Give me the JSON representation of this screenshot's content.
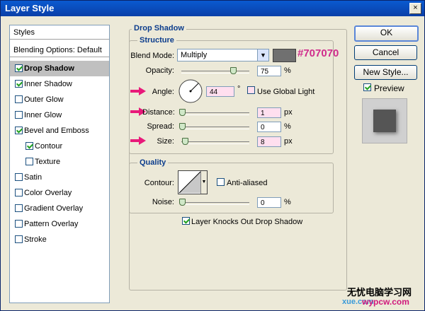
{
  "window": {
    "title": "Layer Style",
    "close_glyph": "×"
  },
  "left_panel": {
    "styles_label": "Styles",
    "blending_label": "Blending Options: Default",
    "items": [
      {
        "label": "Drop Shadow",
        "checked": true,
        "selected": true
      },
      {
        "label": "Inner Shadow",
        "checked": true
      },
      {
        "label": "Outer Glow",
        "checked": false
      },
      {
        "label": "Inner Glow",
        "checked": false
      },
      {
        "label": "Bevel and Emboss",
        "checked": true
      },
      {
        "label": "Contour",
        "checked": true
      },
      {
        "label": "Texture",
        "checked": false
      },
      {
        "label": "Satin",
        "checked": false
      },
      {
        "label": "Color Overlay",
        "checked": false
      },
      {
        "label": "Gradient Overlay",
        "checked": false
      },
      {
        "label": "Pattern Overlay",
        "checked": false
      },
      {
        "label": "Stroke",
        "checked": false
      }
    ]
  },
  "drop_shadow": {
    "group_title": "Drop Shadow",
    "structure_title": "Structure",
    "blend_mode_label": "Blend Mode:",
    "blend_mode_value": "Multiply",
    "color_hex": "#707070",
    "opacity_label": "Opacity:",
    "opacity_value": "75",
    "opacity_unit": "%",
    "opacity_fraction": 0.75,
    "angle_label": "Angle:",
    "angle_value": "44",
    "angle_unit": "°",
    "use_global_light_label": "Use Global Light",
    "use_global_light_checked": false,
    "distance_label": "Distance:",
    "distance_value": "1",
    "distance_unit": "px",
    "distance_fraction": 0.0,
    "spread_label": "Spread:",
    "spread_value": "0",
    "spread_unit": "%",
    "spread_fraction": 0.0,
    "size_label": "Size:",
    "size_value": "8",
    "size_unit": "px",
    "size_fraction": 0.04,
    "quality_title": "Quality",
    "contour_label": "Contour:",
    "anti_aliased_label": "Anti-aliased",
    "anti_aliased_checked": false,
    "noise_label": "Noise:",
    "noise_value": "0",
    "noise_unit": "%",
    "noise_fraction": 0.0,
    "knockout_label": "Layer Knocks Out Drop Shadow",
    "knockout_checked": true
  },
  "buttons": {
    "ok": "OK",
    "cancel": "Cancel",
    "new_style": "New Style..."
  },
  "preview": {
    "label": "Preview",
    "checked": true
  },
  "watermark": {
    "line1": "无忧电脑学习网",
    "line2": "wypcw.com",
    "line3": "xue.com"
  },
  "colors": {
    "accent_arrow": "#e8197a",
    "hex_label": "#d02c8c",
    "group_title": "#0b3c8c",
    "swatch": "#707070"
  }
}
